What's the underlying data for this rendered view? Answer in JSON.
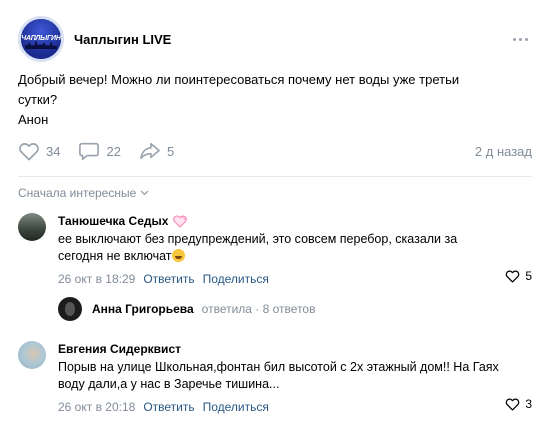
{
  "post": {
    "community_name": "Чаплыгин LIVE",
    "avatar_text": "ЧАПЛЫГИН",
    "text_lines": [
      "Добрый вечер! Можно ли поинтересоваться почему нет воды уже третьи",
      "сутки?",
      "Анон"
    ],
    "likes": "34",
    "comments": "22",
    "shares": "5",
    "time": "2 д назад"
  },
  "comments_sort": "Сначала интересные",
  "comments": [
    {
      "author": "Танюшечка Седых",
      "text_lines": [
        "ее выключают без предупреждений, это совсем перебор, сказали за",
        "сегодня не включат"
      ],
      "date": "26 окт в 18:29",
      "reply_label": "Ответить",
      "share_label": "Поделиться",
      "likes": "5",
      "reply": {
        "author": "Анна Григорьева",
        "info": "ответила · 8 ответов"
      }
    },
    {
      "author": "Евгения Сидерквист",
      "text_lines": [
        "Порыв на улице Школьная,фонтан бил высотой с 2х этажный дом!! На Гаях",
        "воду дали,а у нас в Заречье тишина..."
      ],
      "date": "26 окт в 20:18",
      "reply_label": "Ответить",
      "share_label": "Поделиться",
      "likes": "3"
    }
  ],
  "icons": {
    "like": "heart-outline-icon",
    "comment": "speech-bubble-icon",
    "share": "share-arrow-icon",
    "more": "more-dots-icon",
    "sort": "chevron-down-icon",
    "badge": "pink-heart-emoji-icon",
    "emoji": "smiling-face-emoji-icon"
  },
  "colors": {
    "secondary_text": "#818c99",
    "link": "#2a5885",
    "icon": "#99a2ad",
    "divider": "#e7e8ec",
    "badge_pink": "#f57fb1"
  }
}
